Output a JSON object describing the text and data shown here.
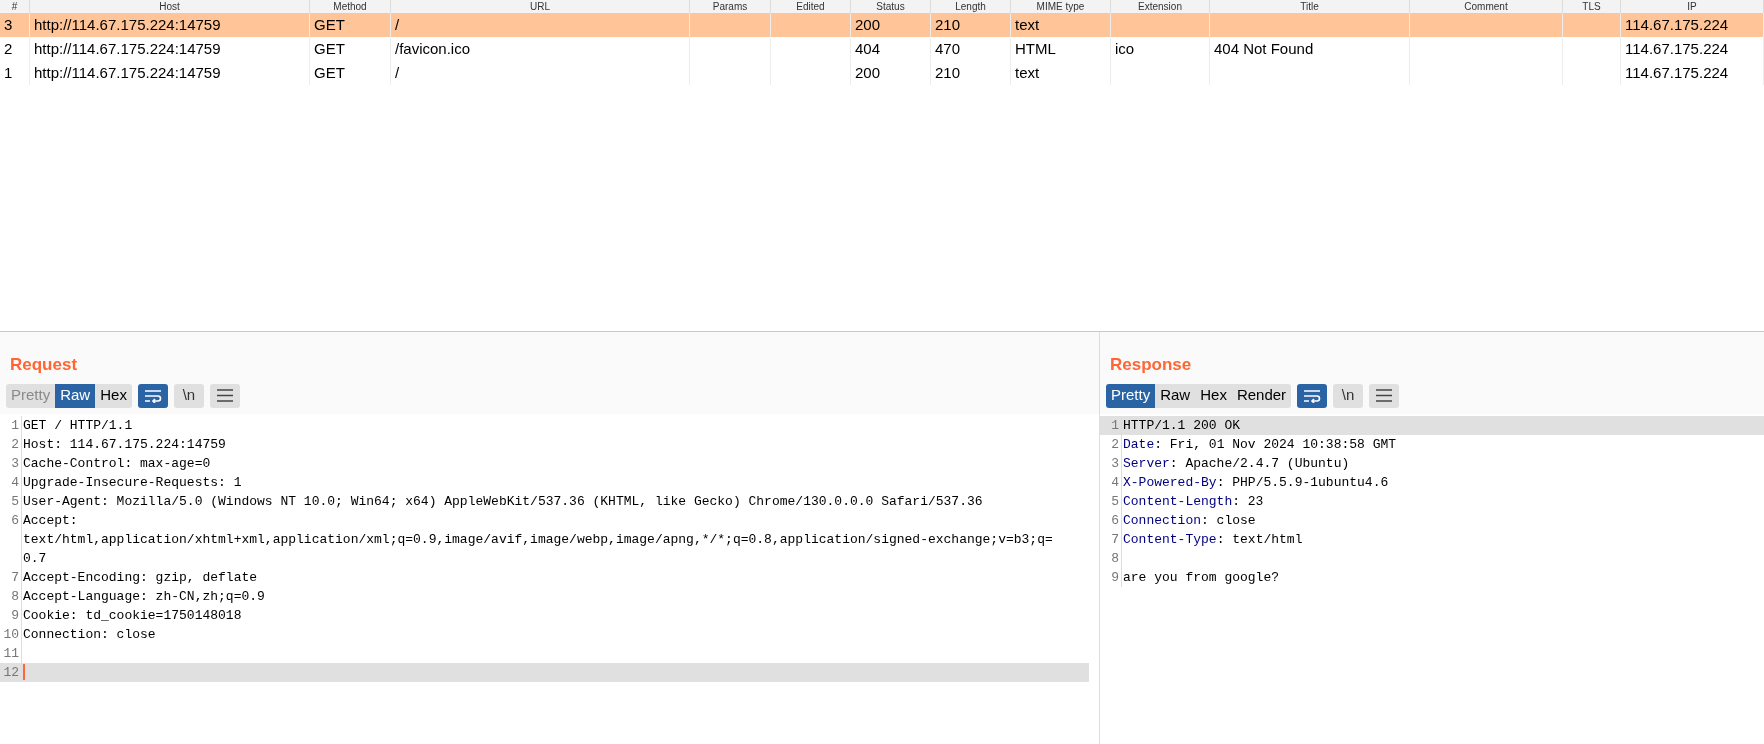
{
  "table": {
    "columns": [
      "#",
      "Host",
      "Method",
      "URL",
      "Params",
      "Edited",
      "Status",
      "Length",
      "MIME type",
      "Extension",
      "Title",
      "Comment",
      "TLS",
      "IP"
    ],
    "rows": [
      {
        "selected": true,
        "cells": [
          "3",
          "http://114.67.175.224:14759",
          "GET",
          "/",
          "",
          "",
          "200",
          "210",
          "text",
          "",
          "",
          "",
          "",
          "114.67.175.224"
        ]
      },
      {
        "selected": false,
        "cells": [
          "2",
          "http://114.67.175.224:14759",
          "GET",
          "/favicon.ico",
          "",
          "",
          "404",
          "470",
          "HTML",
          "ico",
          "404 Not Found",
          "",
          "",
          "114.67.175.224"
        ]
      },
      {
        "selected": false,
        "cells": [
          "1",
          "http://114.67.175.224:14759",
          "GET",
          "/",
          "",
          "",
          "200",
          "210",
          "text",
          "",
          "",
          "",
          "",
          "114.67.175.224"
        ]
      }
    ]
  },
  "request": {
    "title": "Request",
    "view_tabs": [
      {
        "label": "Pretty",
        "selected": false,
        "disabled": true
      },
      {
        "label": "Raw",
        "selected": true,
        "disabled": false
      },
      {
        "label": "Hex",
        "selected": false,
        "disabled": false
      }
    ],
    "wrap_on": true,
    "newline_button": "\\n",
    "lines": [
      {
        "number": "1",
        "text": "GET / HTTP/1.1",
        "current": false
      },
      {
        "number": "2",
        "text": "Host: 114.67.175.224:14759",
        "current": false
      },
      {
        "number": "3",
        "text": "Cache-Control: max-age=0",
        "current": false
      },
      {
        "number": "4",
        "text": "Upgrade-Insecure-Requests: 1",
        "current": false
      },
      {
        "number": "5",
        "text": "User-Agent: Mozilla/5.0 (Windows NT 10.0; Win64; x64) AppleWebKit/537.36 (KHTML, like Gecko) Chrome/130.0.0.0 Safari/537.36",
        "current": false
      },
      {
        "number": "6",
        "text": "Accept:",
        "continuation": [
          "text/html,application/xhtml+xml,application/xml;q=0.9,image/avif,image/webp,image/apng,*/*;q=0.8,application/signed-exchange;v=b3;q=",
          "0.7"
        ],
        "current": false
      },
      {
        "number": "7",
        "text": "Accept-Encoding: gzip, deflate",
        "current": false
      },
      {
        "number": "8",
        "text": "Accept-Language: zh-CN,zh;q=0.9",
        "current": false
      },
      {
        "number": "9",
        "text": "Cookie: td_cookie=1750148018",
        "current": false
      },
      {
        "number": "10",
        "text": "Connection: close",
        "current": false
      },
      {
        "number": "11",
        "current": false
      },
      {
        "number": "12",
        "current": true
      }
    ]
  },
  "response": {
    "title": "Response",
    "view_tabs": [
      {
        "label": "Pretty",
        "selected": true,
        "disabled": false
      },
      {
        "label": "Raw",
        "selected": false,
        "disabled": false
      },
      {
        "label": "Hex",
        "selected": false,
        "disabled": false
      },
      {
        "label": "Render",
        "selected": false,
        "disabled": false
      }
    ],
    "wrap_on": true,
    "newline_button": "\\n",
    "lines": [
      {
        "number": "1",
        "text": "HTTP/1.1 200 OK",
        "current": true
      },
      {
        "number": "2",
        "key": "Date",
        "text": ": Fri, 01 Nov 2024 10:38:58 GMT",
        "current": false
      },
      {
        "number": "3",
        "key": "Server",
        "text": ": Apache/2.4.7 (Ubuntu)",
        "current": false
      },
      {
        "number": "4",
        "key": "X-Powered-By",
        "text": ": PHP/5.5.9-1ubuntu4.6",
        "current": false
      },
      {
        "number": "5",
        "key": "Content-Length",
        "text": ": 23",
        "current": false
      },
      {
        "number": "6",
        "key": "Connection",
        "text": ": close",
        "current": false
      },
      {
        "number": "7",
        "key": "Content-Type",
        "text": ": text/html",
        "current": false
      },
      {
        "number": "8",
        "current": false
      },
      {
        "number": "9",
        "text": "are you from google?",
        "current": false
      }
    ]
  }
}
